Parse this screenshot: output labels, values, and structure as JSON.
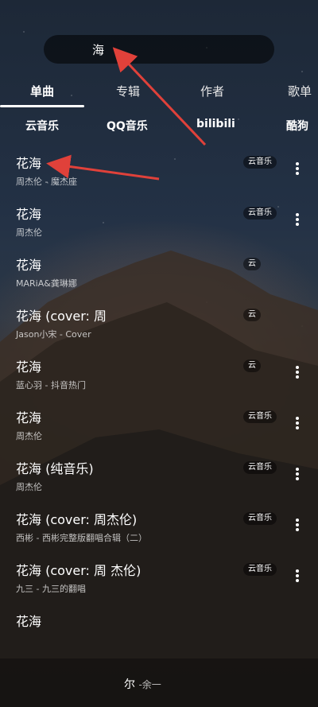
{
  "search": {
    "query": "海"
  },
  "tabs": [
    {
      "label": "单曲"
    },
    {
      "label": "专辑"
    },
    {
      "label": "作者"
    },
    {
      "label": "歌单"
    }
  ],
  "sources": [
    {
      "label": "云音乐"
    },
    {
      "label": "QQ音乐"
    },
    {
      "label": "bilibili"
    },
    {
      "label": "酷狗"
    }
  ],
  "songs": [
    {
      "title": "花海",
      "subtitle": "周杰伦 - 魔杰座",
      "badge": "云音乐"
    },
    {
      "title": "花海",
      "subtitle": "周杰伦",
      "badge": "云音乐"
    },
    {
      "title": "花海",
      "subtitle": "MARiA&龚琳娜",
      "badge": "云"
    },
    {
      "title": "花海 (cover: 周",
      "subtitle": "Jason小宋 - Cover",
      "badge": "云"
    },
    {
      "title": "花海",
      "subtitle": "蓝心羽 - 抖音热门",
      "badge": "云"
    },
    {
      "title": "花海",
      "subtitle": "周杰伦",
      "badge": "云音乐"
    },
    {
      "title": "花海 (纯音乐)",
      "subtitle": "周杰伦",
      "badge": "云音乐"
    },
    {
      "title": "花海 (cover: 周杰伦)",
      "subtitle": "西彬 - 西彬完整版翻唱合辑（二）",
      "badge": "云音乐"
    },
    {
      "title": "花海 (cover: 周 杰伦)",
      "subtitle": "九三 - 九三的翻唱",
      "badge": "云音乐"
    },
    {
      "title": "花海",
      "subtitle": "",
      "badge": ""
    }
  ],
  "now_playing": {
    "title": "尔",
    "artist": "-余一"
  },
  "colors": {
    "accent": "#e0413a"
  }
}
